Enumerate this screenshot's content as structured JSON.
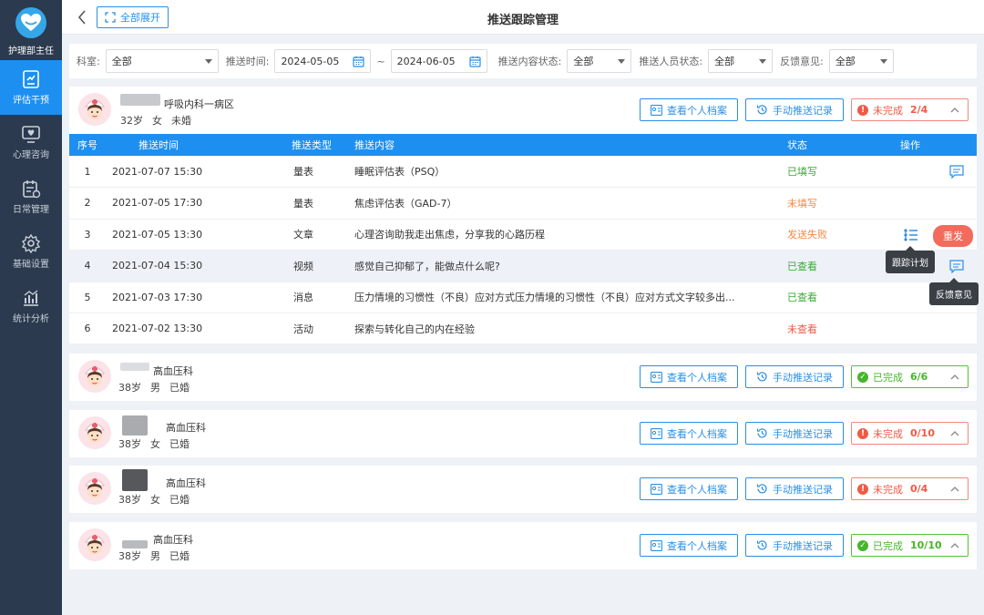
{
  "sidebar": {
    "role": "护理部主任",
    "items": [
      {
        "label": "评估干预",
        "icon": "assessment-icon"
      },
      {
        "label": "心理咨询",
        "icon": "consult-icon"
      },
      {
        "label": "日常管理",
        "icon": "calendar-icon"
      },
      {
        "label": "基础设置",
        "icon": "gear-icon"
      },
      {
        "label": "统计分析",
        "icon": "bar-chart-icon"
      }
    ]
  },
  "header": {
    "expand_all": "全部展开",
    "title": "推送跟踪管理"
  },
  "filters": {
    "dept_label": "科室:",
    "dept_value": "全部",
    "time_label": "推送时间:",
    "date_from": "2024-05-05",
    "tilde": "~",
    "date_to": "2024-06-05",
    "content_status_label": "推送内容状态:",
    "content_status_value": "全部",
    "person_status_label": "推送人员状态:",
    "person_status_value": "全部",
    "feedback_label": "反馈意见:",
    "feedback_value": "全部"
  },
  "actions": {
    "profile": "查看个人档案",
    "records": "手动推送记录"
  },
  "groups": [
    {
      "dept": "呼吸内科一病区",
      "age": "32岁",
      "gender": "女",
      "marital": "未婚",
      "status": "未完成",
      "count": "2/4",
      "status_type": "fail",
      "expanded": true
    },
    {
      "dept": "高血压科",
      "age": "38岁",
      "gender": "男",
      "marital": "已婚",
      "status": "已完成",
      "count": "6/6",
      "status_type": "ok"
    },
    {
      "dept": "高血压科",
      "age": "38岁",
      "gender": "女",
      "marital": "已婚",
      "status": "未完成",
      "count": "0/10",
      "status_type": "fail"
    },
    {
      "dept": "高血压科",
      "age": "38岁",
      "gender": "女",
      "marital": "已婚",
      "status": "未完成",
      "count": "0/4",
      "status_type": "fail"
    },
    {
      "dept": "高血压科",
      "age": "38岁",
      "gender": "男",
      "marital": "已婚",
      "status": "已完成",
      "count": "10/10",
      "status_type": "ok"
    }
  ],
  "table": {
    "headers": [
      "序号",
      "推送时间",
      "推送类型",
      "推送内容",
      "状态",
      "操作"
    ],
    "rows": [
      {
        "no": "1",
        "time": "2021-07-07  15:30",
        "type": "量表",
        "content": "睡眠评估表（PSQ）",
        "status": "已填写",
        "status_color": "#3aaa35"
      },
      {
        "no": "2",
        "time": "2021-07-05  17:30",
        "type": "量表",
        "content": "焦虑评估表（GAD-7）",
        "status": "未填写",
        "status_color": "#f28a47"
      },
      {
        "no": "3",
        "time": "2021-07-05  13:30",
        "type": "文章",
        "content": "心理咨询助我走出焦虑，分享我的心路历程",
        "status": "发送失败",
        "status_color": "#f28a47"
      },
      {
        "no": "4",
        "time": "2021-07-04  15:30",
        "type": "视频",
        "content": "感觉自己抑郁了，能做点什么呢?",
        "status": "已查看",
        "status_color": "#3aaa35"
      },
      {
        "no": "5",
        "time": "2021-07-03  17:30",
        "type": "消息",
        "content": "压力情境的习惯性（不良）应对方式压力情境的习惯性（不良）应对方式文字较多出...",
        "status": "已查看",
        "status_color": "#3aaa35"
      },
      {
        "no": "6",
        "time": "2021-07-02  13:30",
        "type": "活动",
        "content": "探索与转化自己的内在经验",
        "status": "未查看",
        "status_color": "#f05a45"
      }
    ],
    "resend": "重发",
    "tooltip_plan": "跟踪计划",
    "tooltip_feedback": "反馈意见"
  },
  "colors": {
    "primary": "#1d8ff0",
    "sidebar": "#2b3a4e",
    "fail": "#f05a45",
    "ok": "#46b52a"
  }
}
